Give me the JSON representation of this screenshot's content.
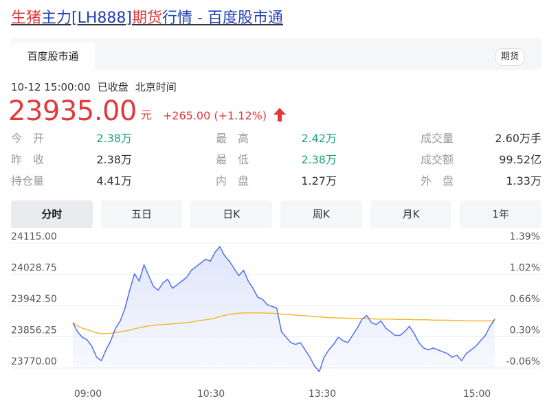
{
  "title": {
    "p1": "生猪",
    "p2": "主力[LH888]",
    "p3": "期货",
    "p4": "行情 - 百度股市通"
  },
  "source_tab": "百度股市通",
  "category_tag": "期货",
  "status": {
    "datetime": "10-12 15:00:00",
    "state": "已收盘",
    "timezone": "北京时间"
  },
  "quote": {
    "price": "23935.00",
    "unit": "元",
    "change": "+265.00 (+1.12%)",
    "direction": "up",
    "up_color": "#e4393c",
    "down_color": "#1aa67c"
  },
  "stats": [
    {
      "label": "今　开",
      "value": "2.38万",
      "color": "green"
    },
    {
      "label": "最　高",
      "value": "2.42万",
      "color": "green"
    },
    {
      "label": "成交量",
      "value": "2.60万手",
      "color": ""
    },
    {
      "label": "昨　收",
      "value": "2.38万",
      "color": ""
    },
    {
      "label": "最　低",
      "value": "2.38万",
      "color": "green"
    },
    {
      "label": "成交额",
      "value": "99.52亿",
      "color": ""
    },
    {
      "label": "持仓量",
      "value": "4.41万",
      "color": ""
    },
    {
      "label": "内　盘",
      "value": "1.27万",
      "color": ""
    },
    {
      "label": "外　盘",
      "value": "1.33万",
      "color": ""
    }
  ],
  "period_tabs": [
    {
      "label": "分时",
      "active": true
    },
    {
      "label": "五日",
      "active": false
    },
    {
      "label": "日K",
      "active": false
    },
    {
      "label": "周K",
      "active": false
    },
    {
      "label": "月K",
      "active": false
    },
    {
      "label": "1年",
      "active": false
    }
  ],
  "chart_data": {
    "type": "line",
    "y_left_ticks": [
      "24115.00",
      "24028.75",
      "23942.50",
      "23856.25",
      "23770.00"
    ],
    "y_right_ticks": [
      "1.39%",
      "1.02%",
      "0.66%",
      "0.30%",
      "-0.06%"
    ],
    "x_ticks": [
      "09:00",
      "10:30",
      "13:30",
      "15:00"
    ],
    "ylim": [
      23770,
      24115
    ],
    "grid": true,
    "colors": {
      "price": "#4e6ef2",
      "average": "#f5b92e",
      "fill_top": "#dde4fb"
    },
    "series": [
      {
        "values": [
          23895,
          23870,
          23855,
          23848,
          23830,
          23800,
          23790,
          23820,
          23845,
          23880,
          23900,
          23935,
          23985,
          24030,
          24010,
          24055,
          24025,
          23995,
          23985,
          24005,
          24015,
          23990,
          24000,
          24010,
          24020,
          24040,
          24050,
          24060,
          24070,
          24065,
          24090,
          24105,
          24080,
          24065,
          24045,
          24025,
          24040,
          24010,
          23990,
          23965,
          23960,
          23945,
          23940,
          23935,
          23870,
          23855,
          23840,
          23835,
          23840,
          23820,
          23800,
          23775,
          23760,
          23800,
          23820,
          23835,
          23855,
          23845,
          23840,
          23860,
          23880,
          23905,
          23915,
          23895,
          23890,
          23900,
          23880,
          23870,
          23860,
          23860,
          23870,
          23885,
          23865,
          23840,
          23825,
          23820,
          23825,
          23820,
          23815,
          23810,
          23800,
          23805,
          23790,
          23810,
          23820,
          23830,
          23845,
          23860,
          23885,
          23905
        ]
      },
      {
        "values": [
          23895,
          23886,
          23880,
          23876,
          23871,
          23867,
          23865,
          23865,
          23866,
          23868,
          23870,
          23872,
          23875,
          23878,
          23881,
          23884,
          23886,
          23888,
          23889,
          23890,
          23891,
          23892,
          23893,
          23894,
          23895,
          23897,
          23899,
          23901,
          23903,
          23905,
          23908,
          23912,
          23915,
          23918,
          23920,
          23921,
          23922,
          23922,
          23922,
          23922,
          23922,
          23921,
          23921,
          23920,
          23919,
          23918,
          23917,
          23916,
          23915,
          23914,
          23913,
          23912,
          23911,
          23910,
          23909,
          23909,
          23908,
          23908,
          23907,
          23907,
          23907,
          23906,
          23906,
          23906,
          23905,
          23905,
          23905,
          23905,
          23904,
          23904,
          23904,
          23904,
          23903,
          23903,
          23903,
          23903,
          23902,
          23902,
          23902,
          23902,
          23901,
          23901,
          23901,
          23900,
          23900,
          23900,
          23900,
          23900,
          23900,
          23900
        ]
      }
    ]
  }
}
